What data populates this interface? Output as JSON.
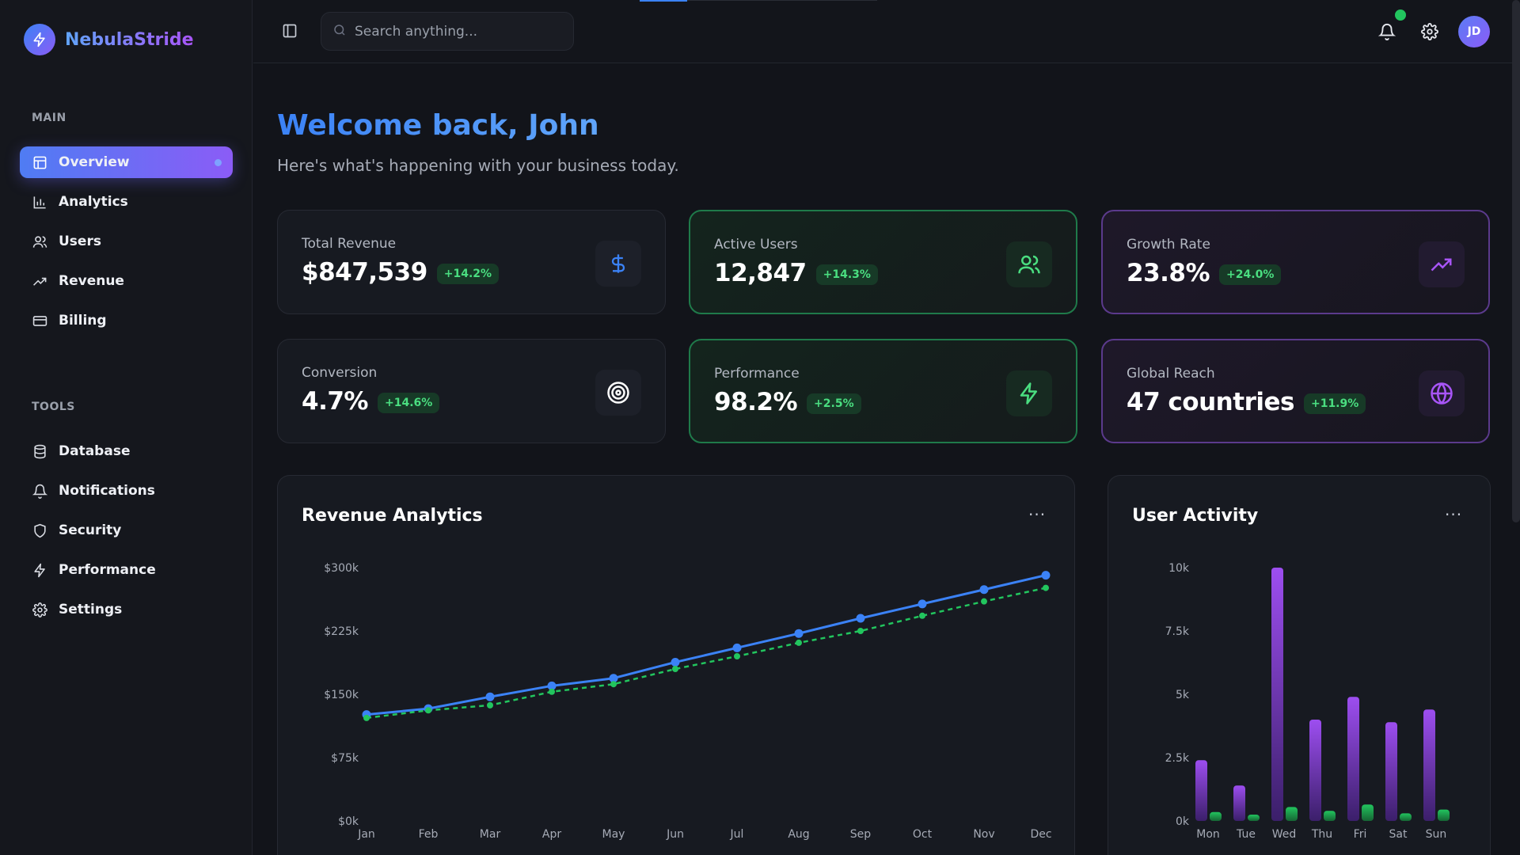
{
  "brand": {
    "name": "NebulaStride"
  },
  "sidebar": {
    "main_label": "MAIN",
    "main_items": [
      {
        "label": "Overview",
        "icon": "layout-icon",
        "active": true
      },
      {
        "label": "Analytics",
        "icon": "bar-chart-icon"
      },
      {
        "label": "Users",
        "icon": "users-icon"
      },
      {
        "label": "Revenue",
        "icon": "trending-up-icon"
      },
      {
        "label": "Billing",
        "icon": "credit-card-icon"
      }
    ],
    "tools_label": "TOOLS",
    "tools_items": [
      {
        "label": "Database",
        "icon": "database-icon"
      },
      {
        "label": "Notifications",
        "icon": "bell-icon"
      },
      {
        "label": "Security",
        "icon": "shield-icon"
      },
      {
        "label": "Performance",
        "icon": "zap-icon"
      },
      {
        "label": "Settings",
        "icon": "gear-icon"
      }
    ]
  },
  "topbar": {
    "search_placeholder": "Search anything...",
    "avatar_initials": "JD"
  },
  "header": {
    "welcome": "Welcome back, John",
    "subtitle": "Here's what's happening with your business today."
  },
  "stats": [
    {
      "label": "Total Revenue",
      "value": "$847,539",
      "change": "+14.2%",
      "icon": "dollar-icon",
      "color": "#3b82f6"
    },
    {
      "label": "Active Users",
      "value": "12,847",
      "change": "+14.3%",
      "icon": "users-icon",
      "color": "#4ade80"
    },
    {
      "label": "Growth Rate",
      "value": "23.8%",
      "change": "+24.0%",
      "icon": "trending-up-icon",
      "color": "#a855f7"
    },
    {
      "label": "Conversion",
      "value": "4.7%",
      "change": "+14.6%",
      "icon": "target-icon",
      "color": "#ffffff"
    },
    {
      "label": "Performance",
      "value": "98.2%",
      "change": "+2.5%",
      "icon": "zap-icon",
      "color": "#4ade80"
    },
    {
      "label": "Global Reach",
      "value": "47 countries",
      "change": "+11.9%",
      "icon": "globe-icon",
      "color": "#a855f7"
    }
  ],
  "revenue_panel": {
    "title": "Revenue Analytics",
    "more": "···"
  },
  "activity_panel": {
    "title": "User Activity",
    "more": "···"
  },
  "chart_data": [
    {
      "type": "line",
      "title": "Revenue Analytics",
      "categories": [
        "Jan",
        "Feb",
        "Mar",
        "Apr",
        "May",
        "Jun",
        "Jul",
        "Aug",
        "Sep",
        "Oct",
        "Nov",
        "Dec"
      ],
      "y_ticks": [
        "$0k",
        "$75k",
        "$150k",
        "$225k",
        "$300k"
      ],
      "ylim": [
        0,
        300000
      ],
      "series": [
        {
          "values": [
            126000,
            133000,
            147000,
            160000,
            169000,
            188000,
            205000,
            222000,
            240000,
            257000,
            274000,
            291000
          ],
          "color": "#3b82f6",
          "style": "solid"
        },
        {
          "values": [
            122000,
            131000,
            137000,
            153000,
            162000,
            180000,
            195000,
            211000,
            225000,
            243000,
            260000,
            276000
          ],
          "color": "#22c55e",
          "style": "dashed"
        }
      ]
    },
    {
      "type": "bar",
      "title": "User Activity",
      "categories": [
        "Mon",
        "Tue",
        "Wed",
        "Thu",
        "Fri",
        "Sat",
        "Sun"
      ],
      "y_ticks": [
        "0k",
        "2.5k",
        "5k",
        "7.5k",
        "10k"
      ],
      "ylim": [
        0,
        10000
      ],
      "series": [
        {
          "values": [
            2400,
            1400,
            10000,
            4000,
            4900,
            3900,
            4400
          ],
          "color": "#9333ea"
        },
        {
          "values": [
            350,
            250,
            550,
            400,
            650,
            300,
            450
          ],
          "color": "#22c55e"
        }
      ]
    }
  ]
}
